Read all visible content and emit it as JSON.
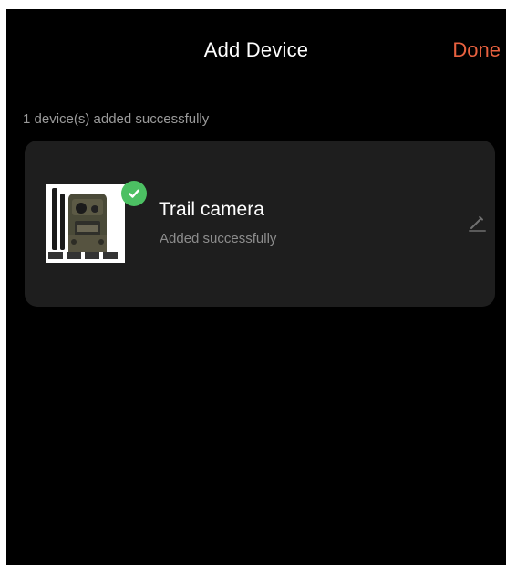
{
  "header": {
    "title": "Add Device",
    "done_label": "Done"
  },
  "status": {
    "message": "1 device(s) added successfully"
  },
  "device": {
    "name": "Trail camera",
    "status": "Added successfully",
    "image_icon": "trail-camera-image",
    "success_icon": "check-icon",
    "edit_icon": "pencil-icon"
  },
  "colors": {
    "background": "#000000",
    "card": "#1e1e1e",
    "accent": "#e8613f",
    "success": "#4cc063",
    "secondary_text": "#8d8d8d"
  }
}
